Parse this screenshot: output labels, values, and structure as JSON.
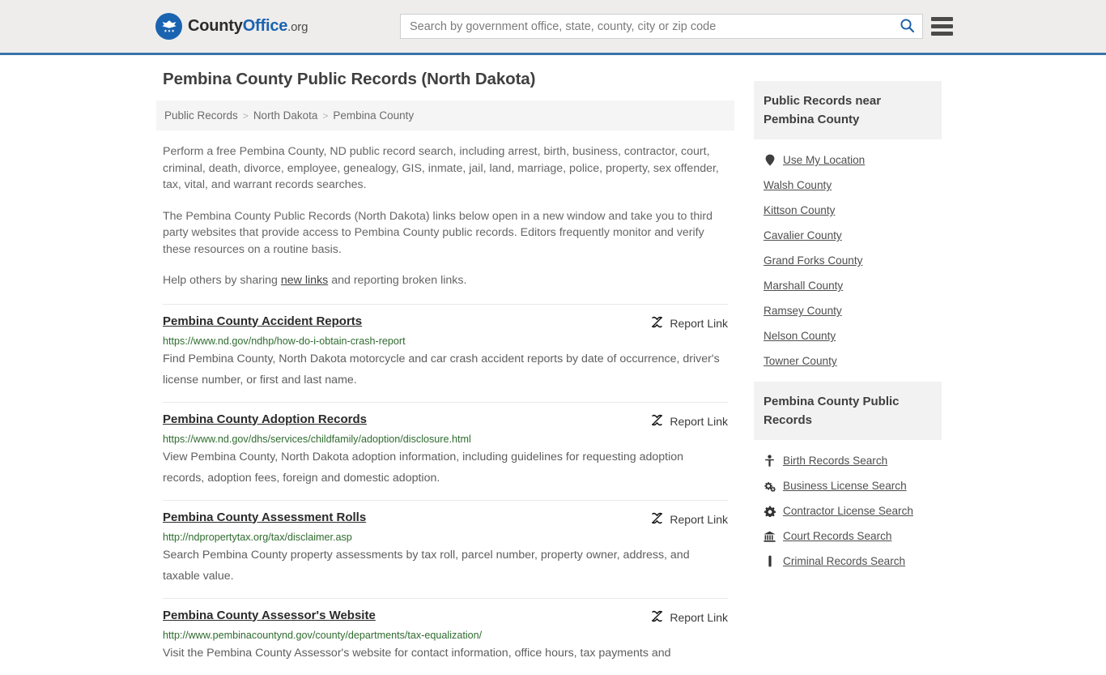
{
  "header": {
    "logo": {
      "icon": "eagle-seal-icon",
      "text_1": "County",
      "text_2": "Office",
      "text_3": ".org"
    },
    "search": {
      "placeholder": "Search by government office, state, county, city or zip code",
      "value": "",
      "icon": "search-icon"
    },
    "menu_icon": "hamburger-menu-icon",
    "accent_color": "#3a72a8"
  },
  "main": {
    "title": "Pembina County Public Records (North Dakota)",
    "breadcrumb": [
      {
        "label": "Public Records"
      },
      {
        "label": "North Dakota"
      },
      {
        "label": "Pembina County"
      }
    ],
    "breadcrumb_separator": ">",
    "intro": {
      "p1": "Perform a free Pembina County, ND public record search, including arrest, birth, business, contractor, court, criminal, death, divorce, employee, genealogy, GIS, inmate, jail, land, marriage, police, property, sex offender, tax, vital, and warrant records searches.",
      "p2": "The Pembina County Public Records (North Dakota) links below open in a new window and take you to third party websites that provide access to Pembina County public records. Editors frequently monitor and verify these resources on a routine basis.",
      "p3_before": "Help others by sharing ",
      "p3_link": "new links",
      "p3_after": " and reporting broken links."
    },
    "report_link_label": "Report Link",
    "report_link_icon": "broken-link-icon",
    "results": [
      {
        "title": "Pembina County Accident Reports",
        "url": "https://www.nd.gov/ndhp/how-do-i-obtain-crash-report",
        "description": "Find Pembina County, North Dakota motorcycle and car crash accident reports by date of occurrence, driver's license number, or first and last name."
      },
      {
        "title": "Pembina County Adoption Records",
        "url": "https://www.nd.gov/dhs/services/childfamily/adoption/disclosure.html",
        "description": "View Pembina County, North Dakota adoption information, including guidelines for requesting adoption records, adoption fees, foreign and domestic adoption."
      },
      {
        "title": "Pembina County Assessment Rolls",
        "url": "http://ndpropertytax.org/tax/disclaimer.asp",
        "description": "Search Pembina County property assessments by tax roll, parcel number, property owner, address, and taxable value."
      },
      {
        "title": "Pembina County Assessor's Website",
        "url": "http://www.pembinacountynd.gov/county/departments/tax-equalization/",
        "description": "Visit the Pembina County Assessor's website for contact information, office hours, tax payments and"
      }
    ]
  },
  "sidebar": {
    "panels": [
      {
        "heading": "Public Records near Pembina County",
        "items": [
          {
            "label": "Use My Location",
            "icon": "map-pin-icon"
          },
          {
            "label": "Walsh County",
            "icon": ""
          },
          {
            "label": "Kittson County",
            "icon": ""
          },
          {
            "label": "Cavalier County",
            "icon": ""
          },
          {
            "label": "Grand Forks County",
            "icon": ""
          },
          {
            "label": "Marshall County",
            "icon": ""
          },
          {
            "label": "Ramsey County",
            "icon": ""
          },
          {
            "label": "Nelson County",
            "icon": ""
          },
          {
            "label": "Towner County",
            "icon": ""
          }
        ]
      },
      {
        "heading": "Pembina County Public Records",
        "items": [
          {
            "label": "Birth Records Search",
            "icon": "baby-icon"
          },
          {
            "label": "Business License Search",
            "icon": "gears-icon"
          },
          {
            "label": "Contractor License Search",
            "icon": "gear-icon"
          },
          {
            "label": "Court Records Search",
            "icon": "courthouse-icon"
          },
          {
            "label": "Criminal Records Search",
            "icon": "fingerprint-icon"
          }
        ]
      }
    ]
  }
}
